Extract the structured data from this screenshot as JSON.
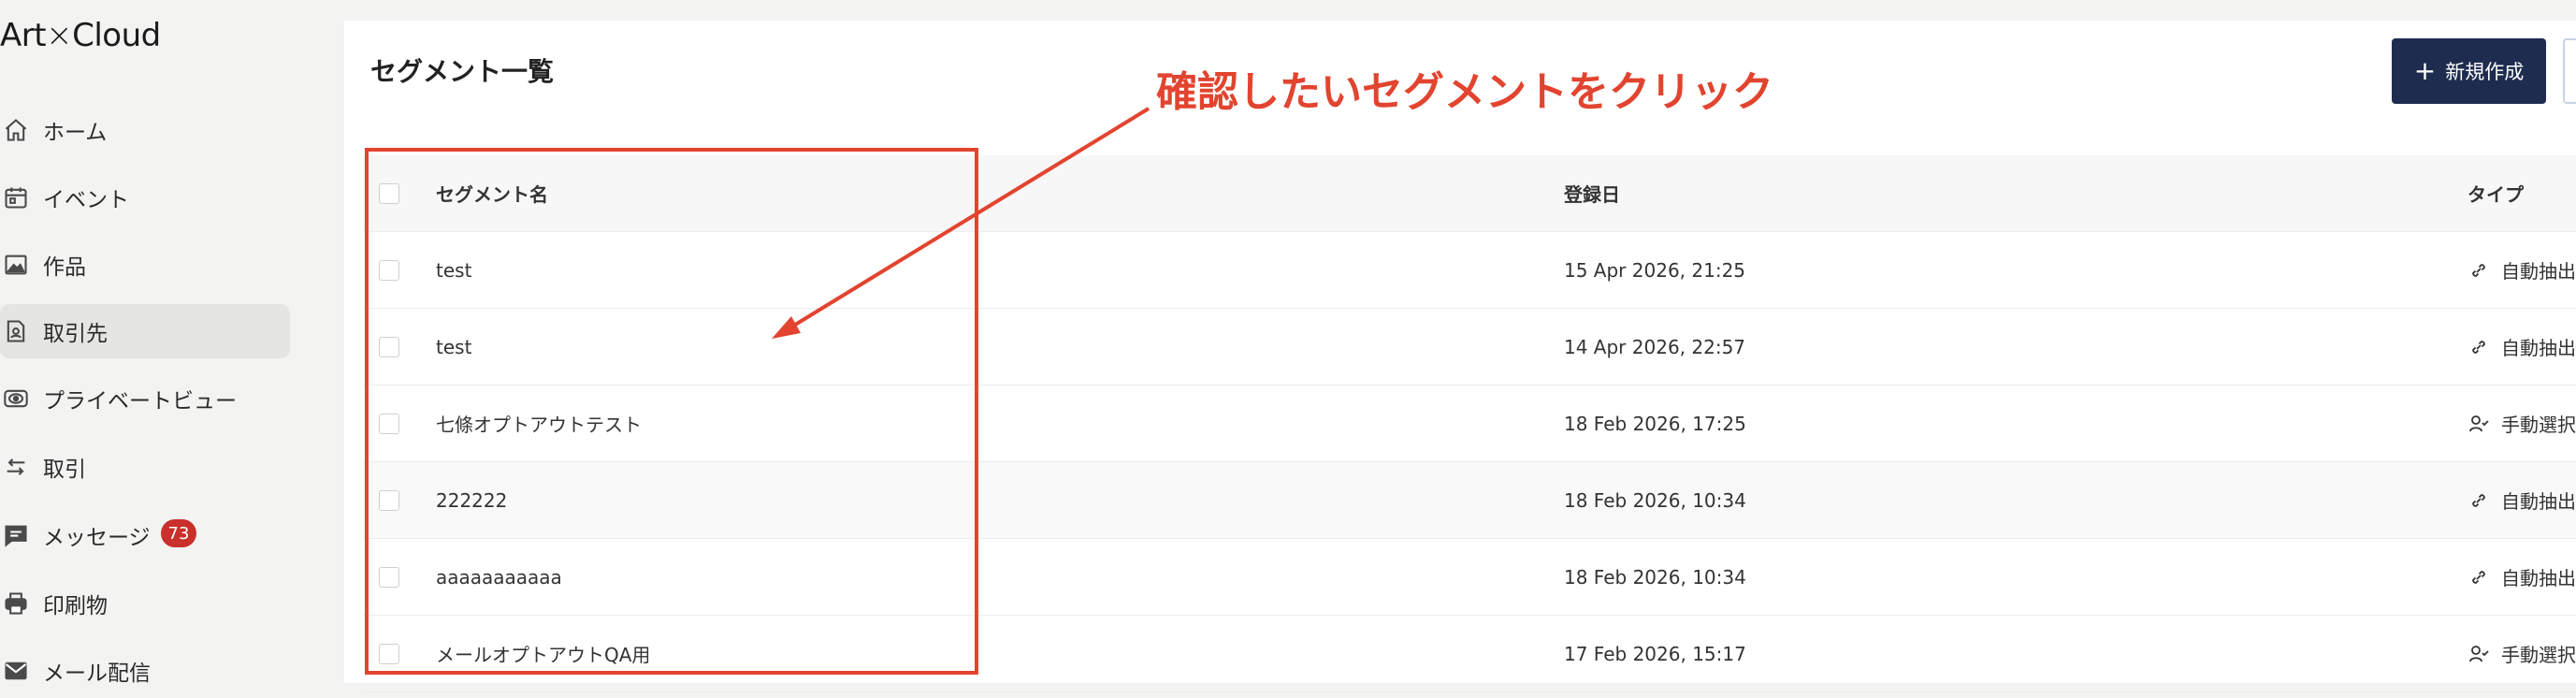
{
  "app": {
    "logo_left": "Art",
    "logo_x": "×",
    "logo_right": "Cloud"
  },
  "sidebar": {
    "items": [
      {
        "label": "ホーム",
        "icon": "home-icon"
      },
      {
        "label": "イベント",
        "icon": "calendar-icon"
      },
      {
        "label": "作品",
        "icon": "image-icon"
      },
      {
        "label": "取引先",
        "icon": "contact-icon",
        "active": true
      },
      {
        "label": "プライベートビュー",
        "icon": "eye-icon"
      },
      {
        "label": "取引",
        "icon": "swap-icon"
      },
      {
        "label": "メッセージ",
        "icon": "message-icon",
        "badge": "73"
      },
      {
        "label": "印刷物",
        "icon": "printer-icon"
      },
      {
        "label": "メール配信",
        "icon": "mail-icon"
      }
    ]
  },
  "main": {
    "title": "セグメント一覧",
    "new_button": "新規作成"
  },
  "table": {
    "headers": {
      "name": "セグメント名",
      "date": "登録日",
      "type": "タイプ"
    },
    "rows": [
      {
        "name": "test",
        "date": "15 Apr 2026, 21:25",
        "type": "自動抽出",
        "type_icon": "link-icon"
      },
      {
        "name": "test",
        "date": "14 Apr 2026, 22:57",
        "type": "自動抽出",
        "type_icon": "link-icon"
      },
      {
        "name": "七條オプトアウトテスト",
        "date": "18 Feb 2026, 17:25",
        "type": "手動選択",
        "type_icon": "people-icon"
      },
      {
        "name": "222222",
        "date": "18 Feb 2026, 10:34",
        "type": "自動抽出",
        "type_icon": "link-icon"
      },
      {
        "name": "aaaaaaaaaaa",
        "date": "18 Feb 2026, 10:34",
        "type": "自動抽出",
        "type_icon": "link-icon"
      },
      {
        "name": "メールオプトアウトQA用",
        "date": "17 Feb 2026, 15:17",
        "type": "手動選択",
        "type_icon": "people-icon"
      }
    ]
  },
  "annotation": {
    "text": "確認したいセグメントをクリック",
    "color": "#e2442f"
  },
  "colors": {
    "primary_button": "#1e2d4f",
    "badge": "#c9302c",
    "sidebar_bg": "#f3f3f1"
  }
}
